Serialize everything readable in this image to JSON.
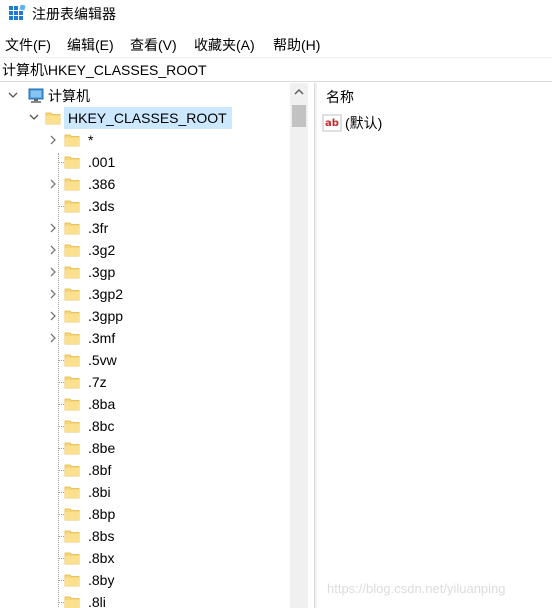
{
  "window": {
    "title": "注册表编辑器"
  },
  "menu": {
    "items": [
      {
        "label": "文件(F)"
      },
      {
        "label": "编辑(E)"
      },
      {
        "label": "查看(V)"
      },
      {
        "label": "收藏夹(A)"
      },
      {
        "label": "帮助(H)"
      }
    ]
  },
  "address": {
    "path": "计算机\\HKEY_CLASSES_ROOT"
  },
  "tree": {
    "computer": {
      "label": "计算机",
      "expanded": true
    },
    "root": {
      "label": "HKEY_CLASSES_ROOT",
      "expanded": true,
      "selected": true
    },
    "children": [
      {
        "label": "*",
        "expandable": true
      },
      {
        "label": ".001",
        "expandable": false
      },
      {
        "label": ".386",
        "expandable": true
      },
      {
        "label": ".3ds",
        "expandable": false
      },
      {
        "label": ".3fr",
        "expandable": true
      },
      {
        "label": ".3g2",
        "expandable": true
      },
      {
        "label": ".3gp",
        "expandable": true
      },
      {
        "label": ".3gp2",
        "expandable": true
      },
      {
        "label": ".3gpp",
        "expandable": true
      },
      {
        "label": ".3mf",
        "expandable": true
      },
      {
        "label": ".5vw",
        "expandable": false
      },
      {
        "label": ".7z",
        "expandable": false
      },
      {
        "label": ".8ba",
        "expandable": false
      },
      {
        "label": ".8bc",
        "expandable": false
      },
      {
        "label": ".8be",
        "expandable": false
      },
      {
        "label": ".8bf",
        "expandable": false
      },
      {
        "label": ".8bi",
        "expandable": false
      },
      {
        "label": ".8bp",
        "expandable": false
      },
      {
        "label": ".8bs",
        "expandable": false
      },
      {
        "label": ".8bx",
        "expandable": false
      },
      {
        "label": ".8by",
        "expandable": false
      },
      {
        "label": ".8li",
        "expandable": false
      }
    ]
  },
  "values": {
    "column_name": "名称",
    "rows": [
      {
        "name": "(默认)",
        "icon": "string-value-icon"
      }
    ]
  },
  "watermark": "https://blog.csdn.net/yiluanping",
  "colors": {
    "selection": "#cce8ff",
    "folder": "#f8d775",
    "folder_dark": "#e0b64a",
    "accent": "#0078d7"
  }
}
